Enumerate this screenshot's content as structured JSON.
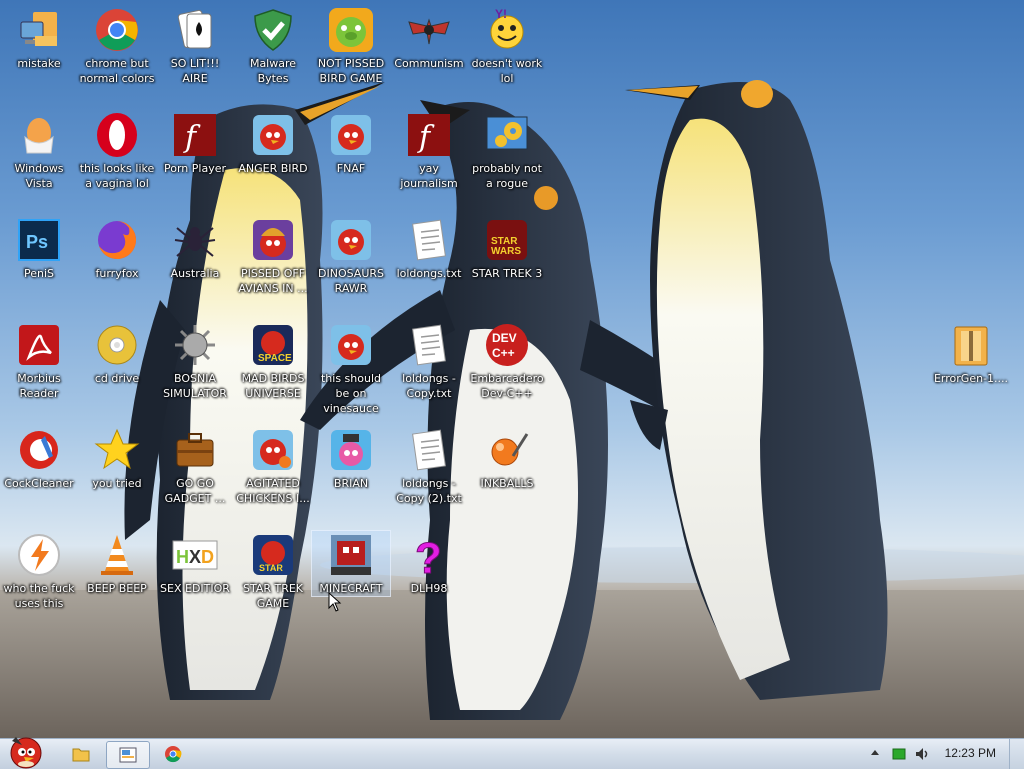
{
  "desktop_icons": [
    {
      "id": "mistake",
      "label": "mistake",
      "icon": "computer-folder-icon"
    },
    {
      "id": "chrome",
      "label": "chrome but normal colors",
      "icon": "chrome-icon"
    },
    {
      "id": "solitaire",
      "label": "SO LIT!!! AIRE",
      "icon": "playing-cards-icon"
    },
    {
      "id": "malwarebytes",
      "label": "Malware Bytes",
      "icon": "shield-check-icon"
    },
    {
      "id": "notpissed",
      "label": "NOT PISSED BIRD GAME",
      "icon": "green-pig-icon"
    },
    {
      "id": "communism",
      "label": "Communism",
      "icon": "eagle-emblem-icon"
    },
    {
      "id": "yahoo",
      "label": "doesn't work lol",
      "icon": "yahoo-smiley-icon"
    },
    {
      "id": "vista",
      "label": "Windows Vista",
      "icon": "egg-icon"
    },
    {
      "id": "opera",
      "label": "this looks like a vagina lol",
      "icon": "opera-icon"
    },
    {
      "id": "flash1",
      "label": "Porn Player",
      "icon": "flash-icon"
    },
    {
      "id": "angerbird",
      "label": "ANGER BIRD",
      "icon": "angry-bird-icon"
    },
    {
      "id": "fnaf",
      "label": "FNAF",
      "icon": "angry-bird-icon"
    },
    {
      "id": "flash2",
      "label": "yay journalism",
      "icon": "flash-icon"
    },
    {
      "id": "rogue",
      "label": "probably not a rogue",
      "icon": "gears-window-icon"
    },
    {
      "id": "photoshop",
      "label": "PeniS",
      "icon": "photoshop-icon"
    },
    {
      "id": "firefox",
      "label": "furryfox",
      "icon": "firefox-icon"
    },
    {
      "id": "australia",
      "label": "Australia",
      "icon": "spider-icon"
    },
    {
      "id": "seasons",
      "label": "PISSED OFF AVIANS IN ...",
      "icon": "angry-birds-seasons-icon"
    },
    {
      "id": "dinosaurs",
      "label": "DINOSAURS RAWR",
      "icon": "angry-bird-icon"
    },
    {
      "id": "loldongs",
      "label": "loldongs.txt",
      "icon": "text-document-icon"
    },
    {
      "id": "startrek3",
      "label": "STAR TREK 3",
      "icon": "star-wars-game-icon"
    },
    {
      "id": "morbius",
      "label": "Morbius Reader",
      "icon": "pdf-reader-icon"
    },
    {
      "id": "cddrive",
      "label": "cd drive",
      "icon": "cd-disc-icon"
    },
    {
      "id": "bosnia",
      "label": "BOSNIA SIMULATOR",
      "icon": "spiked-mine-icon"
    },
    {
      "id": "madbirds",
      "label": "MAD BIRDS UNIVERSE",
      "icon": "angry-birds-space-icon"
    },
    {
      "id": "vinesauce",
      "label": "this should be on vinesauce",
      "icon": "angry-bird-icon"
    },
    {
      "id": "loldongscopy",
      "label": "loldongs - Copy.txt",
      "icon": "text-document-icon"
    },
    {
      "id": "devcpp",
      "label": "Embarcadero Dev-C++",
      "icon": "dev-cpp-icon"
    },
    {
      "id": "cockcleaner",
      "label": "CockCleaner",
      "icon": "ccleaner-icon"
    },
    {
      "id": "youtried",
      "label": "you tried",
      "icon": "star-icon"
    },
    {
      "id": "gogadget",
      "label": "GO GO GADGET ...",
      "icon": "briefcase-icon"
    },
    {
      "id": "agitated",
      "label": "AGITATED CHICKENS I...",
      "icon": "angry-bird-icon"
    },
    {
      "id": "brian",
      "label": "BRIAN",
      "icon": "angry-birds-rio-icon"
    },
    {
      "id": "loldongscopy2",
      "label": "loldongs - Copy (2).txt",
      "icon": "text-document-icon"
    },
    {
      "id": "inkballs",
      "label": "INKBALLS",
      "icon": "ink-ball-icon"
    },
    {
      "id": "whothefuck",
      "label": "who the fuck uses this",
      "icon": "lightning-icon"
    },
    {
      "id": "beepbeep",
      "label": "BEEP BEEP",
      "icon": "vlc-cone-icon"
    },
    {
      "id": "sexeditior",
      "label": "SEX EDITIOR",
      "icon": "hex-editor-icon"
    },
    {
      "id": "startrekgame",
      "label": "STAR TREK GAME",
      "icon": "angry-birds-star-wars-icon"
    },
    {
      "id": "minecraft",
      "label": "MINECRAFT",
      "icon": "minecraft-angry-bird-icon"
    },
    {
      "id": "dlh98",
      "label": "DLH98",
      "icon": "question-mark-icon"
    },
    {
      "id": "errorgen",
      "label": "ErrorGen-1....",
      "icon": "zip-folder-icon"
    }
  ],
  "selected_icon": "MINECRAFT",
  "taskbar": {
    "start_icon": "angry-bird-start-icon",
    "pinned": [
      "folder-icon",
      "active-window-icon",
      "chrome-icon"
    ],
    "clock": "12:23 PM"
  },
  "colors": {
    "taskbar_top": "#e8eef6",
    "taskbar_bottom": "#c3cfde",
    "sky": "#6b9cd2",
    "label_text": "#ffffff"
  }
}
